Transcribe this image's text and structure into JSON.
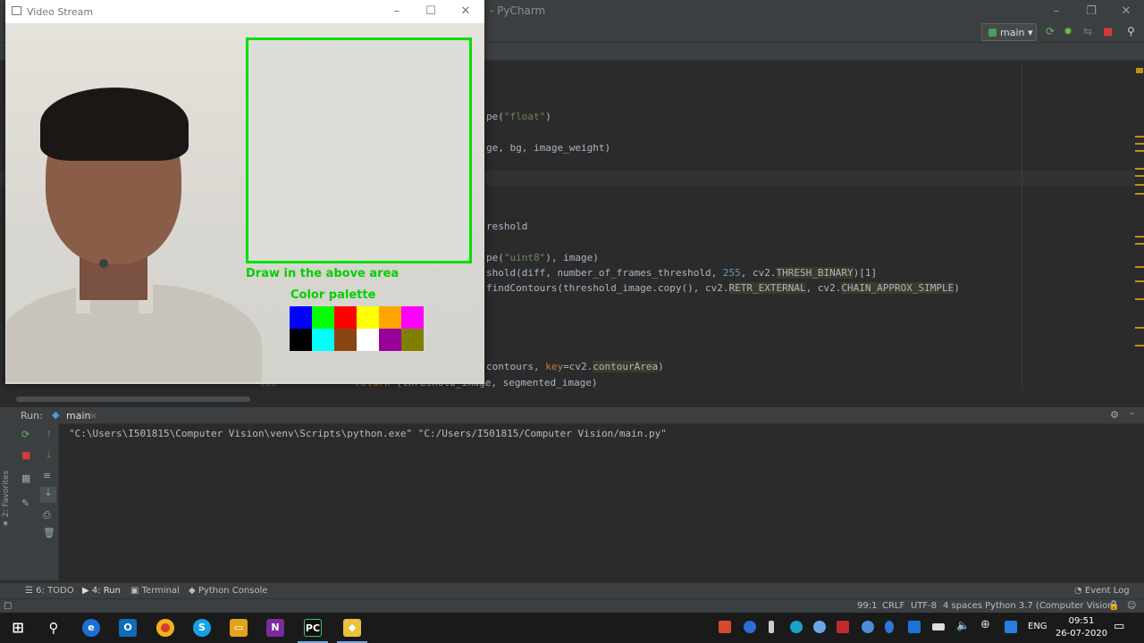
{
  "ide": {
    "title": "- PyCharm",
    "run_config": "main",
    "code_lines": [
      {
        "text_before": "pe(",
        "string": "\"float\"",
        "text_after": ")"
      },
      {
        "text_before": "ge, bg, image_weight)"
      },
      {
        "text_before": "reshold"
      },
      {
        "text_before": "pe(",
        "string": "\"uint8\"",
        "text_after": "), image)"
      },
      {
        "text_before": "shold(diff, number_of_frames_threshold, ",
        "number": "255",
        "text_after": ", cv2.",
        "hl": "THRESH_BINARY",
        "text_end": ")[1]"
      },
      {
        "text_before": "findContours(threshold_image.copy(), cv2.",
        "hl": "RETR_EXTERNAL",
        "text_after": ", cv2.",
        "hl2": "CHAIN_APPROX_SIMPLE",
        "text_end": ")"
      },
      {
        "text_before": "contours, ",
        "param": "key",
        "text_after": "=cv2.",
        "hl": "contourArea",
        "text_end": ")"
      },
      {
        "keyword": "return",
        "text_after": " (threshold_image, segmented_image)",
        "line_no": "112"
      }
    ]
  },
  "video_window": {
    "title": "Video Stream",
    "draw_label": "Draw in the above area",
    "palette_label": "Color palette",
    "palette_colors": [
      "#0000ff",
      "#00ff00",
      "#ff0000",
      "#ffff00",
      "#ffa500",
      "#ff00ff",
      "#000000",
      "#00ffff",
      "#8b4513",
      "#ffffff",
      "#990099",
      "#808000"
    ]
  },
  "run_panel": {
    "label": "Run:",
    "tab": "main",
    "console": "\"C:\\Users\\I501815\\Computer Vision\\venv\\Scripts\\python.exe\" \"C:/Users/I501815/Computer Vision/main.py\""
  },
  "tool_tabs": {
    "todo": "6: TODO",
    "run": "4: Run",
    "terminal": "Terminal",
    "python_console": "Python Console",
    "event_log": "Event Log",
    "favorites": "2: Favorites"
  },
  "status_bar": {
    "position": "99:1",
    "line_sep": "CRLF",
    "encoding": "UTF-8",
    "indent": "4 spaces",
    "interpreter": "Python 3.7 (Computer Vision)"
  },
  "taskbar": {
    "lang": "ENG",
    "time": "09:51",
    "date": "26-07-2020"
  }
}
